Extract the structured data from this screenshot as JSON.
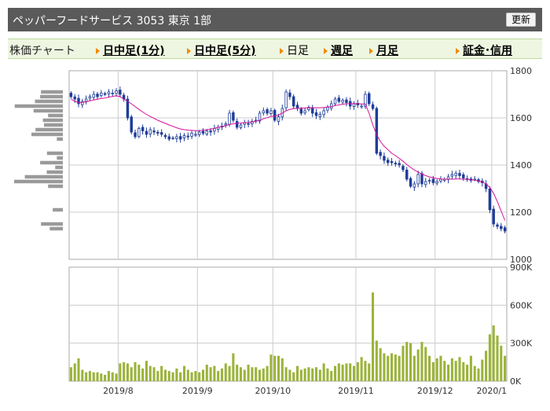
{
  "header": {
    "title": "ペッパーフードサービス 3053 東京 1部",
    "refresh_label": "更新"
  },
  "tabs": {
    "label": "株価チャート",
    "items": [
      {
        "label": "日中足(1分)",
        "style": "link"
      },
      {
        "label": "日中足(5分)",
        "style": "link"
      },
      {
        "label": "日足",
        "style": "plain"
      },
      {
        "label": "週足",
        "style": "link"
      },
      {
        "label": "月足",
        "style": "link"
      },
      {
        "label": "証金･信用",
        "style": "link"
      }
    ]
  },
  "colors": {
    "candle": "#1f3d99",
    "moving_average": "#d4109a",
    "volume_bar": "#9bb33a",
    "volume_profile": "#9a9a9a",
    "grid": "#cccccc"
  },
  "chart_data": [
    {
      "type": "candlestick",
      "ylim": [
        1000,
        1800
      ],
      "y_ticks": [
        "1800",
        "1600",
        "1400",
        "1200",
        "1000"
      ],
      "x_ticks": [
        "2019/8",
        "2019/9",
        "2019/10",
        "2019/11",
        "2019/12",
        "2020/1"
      ],
      "close": [
        1690,
        1680,
        1660,
        1670,
        1680,
        1690,
        1700,
        1690,
        1705,
        1700,
        1710,
        1705,
        1715,
        1700,
        1680,
        1600,
        1540,
        1520,
        1555,
        1545,
        1530,
        1550,
        1540,
        1535,
        1530,
        1520,
        1510,
        1515,
        1520,
        1510,
        1525,
        1520,
        1535,
        1530,
        1540,
        1535,
        1545,
        1540,
        1555,
        1560,
        1565,
        1575,
        1620,
        1590,
        1560,
        1570,
        1580,
        1575,
        1585,
        1590,
        1620,
        1630,
        1620,
        1630,
        1590,
        1605,
        1640,
        1710,
        1690,
        1650,
        1640,
        1620,
        1630,
        1645,
        1620,
        1610,
        1615,
        1630,
        1645,
        1660,
        1680,
        1670,
        1675,
        1665,
        1650,
        1660,
        1655,
        1650,
        1700,
        1660,
        1640,
        1450,
        1440,
        1420,
        1410,
        1410,
        1405,
        1400,
        1380,
        1340,
        1310,
        1320,
        1360,
        1320,
        1330,
        1335,
        1325,
        1330,
        1340,
        1340,
        1350,
        1360,
        1365,
        1355,
        1345,
        1340,
        1335,
        1340,
        1330,
        1325,
        1300,
        1210,
        1150,
        1140,
        1130,
        1120
      ],
      "ma": [
        1680,
        1670,
        1665,
        1666,
        1668,
        1672,
        1676,
        1679,
        1682,
        1684,
        1688,
        1691,
        1694,
        1690,
        1680,
        1670,
        1660,
        1648,
        1636,
        1625,
        1615,
        1606,
        1598,
        1590,
        1583,
        1577,
        1570,
        1564,
        1558,
        1553,
        1550,
        1548,
        1547,
        1546,
        1546,
        1547,
        1550,
        1552,
        1556,
        1560,
        1563,
        1567,
        1572,
        1575,
        1577,
        1578,
        1580,
        1581,
        1583,
        1585,
        1590,
        1596,
        1601,
        1606,
        1608,
        1612,
        1620,
        1630,
        1636,
        1639,
        1641,
        1641,
        1642,
        1643,
        1643,
        1643,
        1643,
        1644,
        1646,
        1648,
        1652,
        1655,
        1658,
        1660,
        1660,
        1661,
        1660,
        1659,
        1659,
        1620,
        1570,
        1530,
        1500,
        1480,
        1465,
        1450,
        1440,
        1428,
        1416,
        1402,
        1390,
        1379,
        1370,
        1362,
        1355,
        1350,
        1346,
        1343,
        1341,
        1340,
        1340,
        1340,
        1341,
        1341,
        1340,
        1340,
        1338,
        1336,
        1332,
        1328,
        1320,
        1305,
        1280,
        1245,
        1205,
        1165
      ],
      "volume_ylim": [
        0,
        900000
      ],
      "volume_ticks": [
        "900K",
        "600K",
        "300K",
        "0K"
      ],
      "volume": [
        110000,
        140000,
        180000,
        90000,
        70000,
        80000,
        70000,
        70000,
        60000,
        50000,
        80000,
        70000,
        60000,
        140000,
        150000,
        140000,
        110000,
        150000,
        130000,
        100000,
        160000,
        120000,
        110000,
        80000,
        120000,
        90000,
        80000,
        70000,
        100000,
        70000,
        120000,
        90000,
        70000,
        80000,
        70000,
        90000,
        130000,
        110000,
        120000,
        80000,
        100000,
        140000,
        120000,
        220000,
        130000,
        110000,
        90000,
        130000,
        110000,
        110000,
        90000,
        100000,
        120000,
        210000,
        200000,
        200000,
        180000,
        110000,
        90000,
        70000,
        120000,
        90000,
        100000,
        110000,
        100000,
        110000,
        90000,
        140000,
        100000,
        80000,
        120000,
        140000,
        130000,
        140000,
        140000,
        120000,
        150000,
        190000,
        160000,
        140000,
        700000,
        320000,
        260000,
        220000,
        200000,
        220000,
        210000,
        200000,
        280000,
        310000,
        300000,
        200000,
        250000,
        310000,
        270000,
        200000,
        150000,
        180000,
        200000,
        160000,
        130000,
        180000,
        160000,
        190000,
        150000,
        130000,
        200000,
        120000,
        100000,
        170000,
        240000,
        370000,
        440000,
        360000,
        280000,
        200000
      ]
    }
  ]
}
